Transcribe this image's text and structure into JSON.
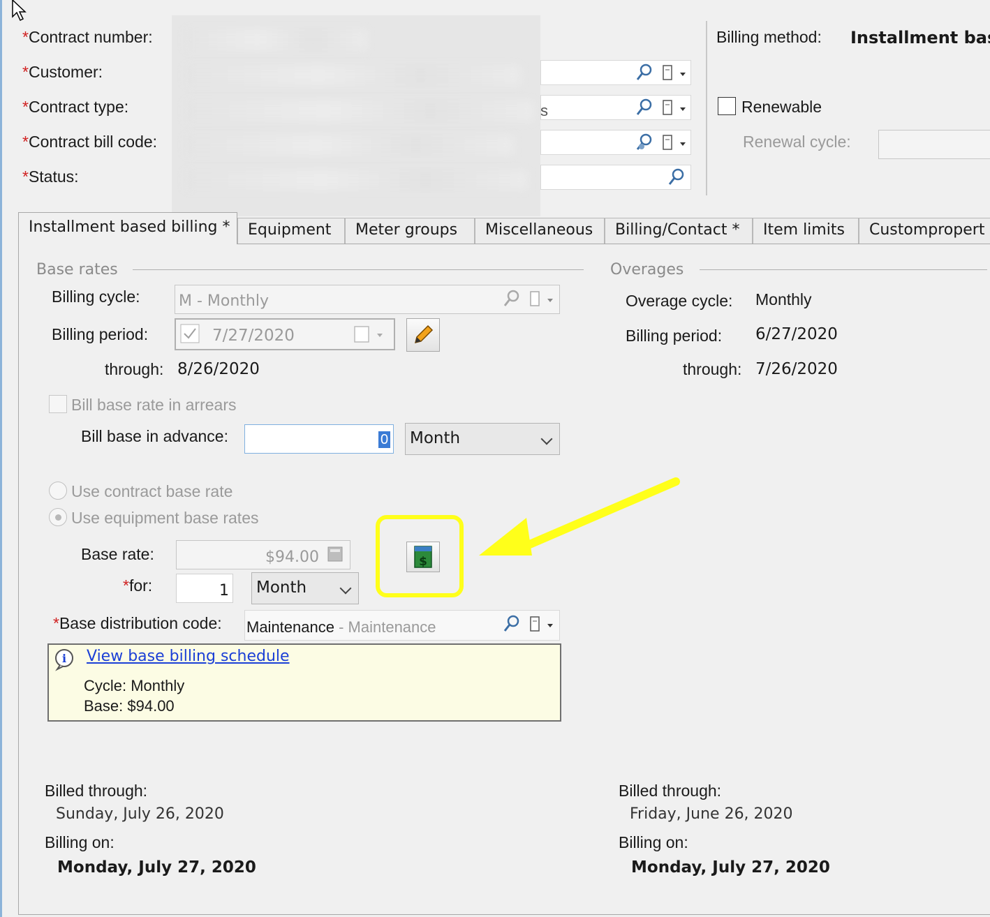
{
  "header": {
    "contract_number_label": "Contract number:",
    "customer_label": "Customer:",
    "contract_type_label": "Contract type:",
    "contract_bill_code_label": "Contract bill code:",
    "status_label": "Status:",
    "contract_type_tail": "s",
    "billing_method_label": "Billing method:",
    "billing_method_value": "Installment base",
    "renewable_label": "Renewable",
    "renewal_cycle_label": "Renewal cycle:"
  },
  "tabs": [
    {
      "label": "Installment based billing *"
    },
    {
      "label": "Equipment"
    },
    {
      "label": "Meter groups"
    },
    {
      "label": "Miscellaneous"
    },
    {
      "label": "Billing/Contact *"
    },
    {
      "label": "Item limits"
    },
    {
      "label": "Custompropert"
    }
  ],
  "base_rates": {
    "group_label": "Base rates",
    "billing_cycle_label": "Billing cycle:",
    "billing_cycle_value": "M - Monthly",
    "billing_period_label": "Billing period:",
    "billing_period_value": "7/27/2020",
    "through_label": "through:",
    "through_value": "8/26/2020",
    "bill_in_arrears_label": "Bill base rate in arrears",
    "bill_in_advance_label": "Bill base in advance:",
    "bill_in_advance_value": "0",
    "bill_in_advance_unit": "Month",
    "use_contract_rate_label": "Use contract base rate",
    "use_equipment_rates_label": "Use equipment base rates",
    "base_rate_label": "Base rate:",
    "base_rate_value": "$94.00",
    "for_label": "for:",
    "for_value": "1",
    "for_unit": "Month",
    "distribution_label": "Base distribution code:",
    "distribution_code": "Maintenance",
    "distribution_desc": " - Maintenance",
    "schedule_link": "View base billing schedule",
    "schedule_cycle": "Cycle: Monthly",
    "schedule_base": "Base: $94.00",
    "billed_through_label": "Billed through:",
    "billed_through_value": "Sunday, July 26, 2020",
    "billing_on_label": "Billing on:",
    "billing_on_value": "Monday, July 27, 2020"
  },
  "overages": {
    "group_label": "Overages",
    "cycle_label": "Overage cycle:",
    "cycle_value": "Monthly",
    "billing_period_label": "Billing period:",
    "billing_period_value": "6/27/2020",
    "through_label": "through:",
    "through_value": "7/26/2020",
    "billed_through_label": "Billed through:",
    "billed_through_value": "Friday, June 26, 2020",
    "billing_on_label": "Billing on:",
    "billing_on_value": "Monday, July 27, 2020"
  },
  "annotation": {
    "highlight_color": "#ffff1a",
    "arrow_color": "#ffff1a"
  }
}
